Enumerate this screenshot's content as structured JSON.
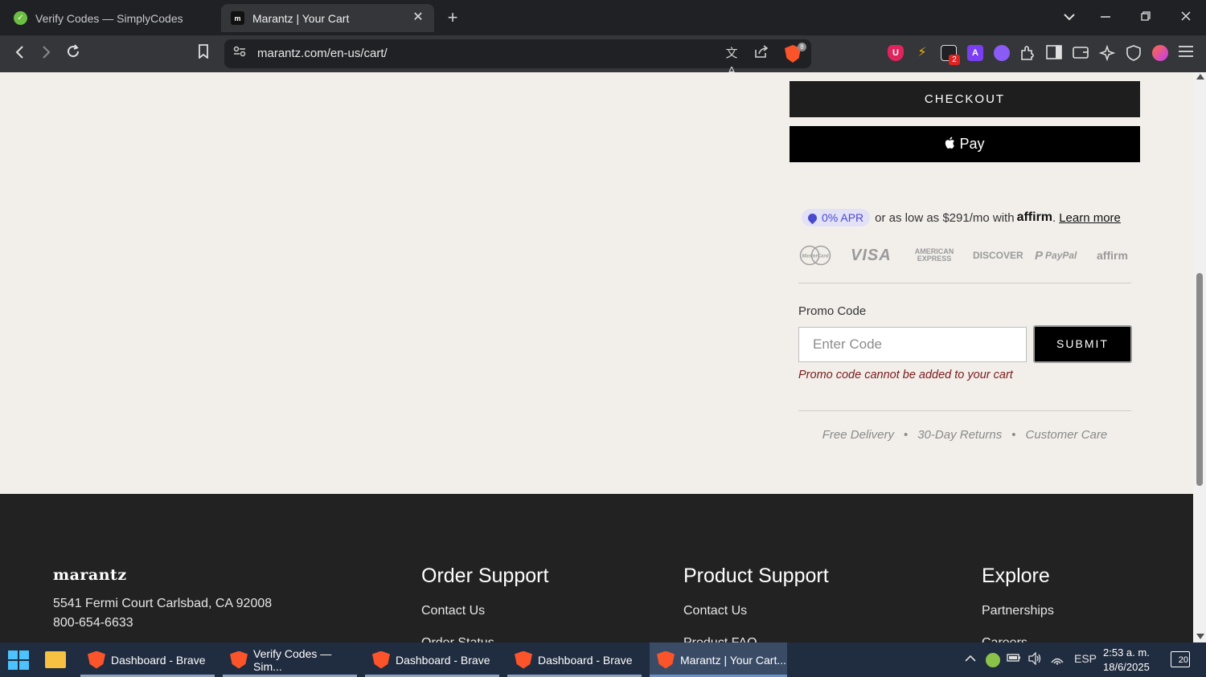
{
  "browser": {
    "tabs": [
      {
        "title": "Verify Codes — SimplyCodes",
        "active": false
      },
      {
        "title": "Marantz | Your Cart",
        "active": true
      }
    ],
    "new_tab_glyph": "+",
    "close_glyph": "✕",
    "url": "marantz.com/en-us/cart/",
    "shields_count": "8",
    "extension_badge": "2",
    "extension_a_letter": "A"
  },
  "cart": {
    "checkout_label": "CHECKOUT",
    "applepay_label": " Pay",
    "affirm": {
      "apr_label": "0% APR",
      "text": "or as low as $291/mo with",
      "brand": "affirm",
      "learn_more": "Learn more"
    },
    "payment_logos": [
      "MasterCard",
      "VISA",
      "AMERICAN EXPRESS",
      "DISCOVER",
      "PayPal",
      "affirm"
    ],
    "promo": {
      "label": "Promo Code",
      "placeholder": "Enter Code",
      "submit_label": "SUBMIT",
      "error": "Promo code cannot be added to your cart"
    },
    "benefits": [
      "Free Delivery",
      "30-Day Returns",
      "Customer Care"
    ],
    "benefit_separator": "•"
  },
  "footer": {
    "brand": "marantz",
    "address": "5541 Fermi Court Carlsbad, CA 92008",
    "phone": "800-654-6633",
    "columns": [
      {
        "title": "Order Support",
        "links": [
          "Contact Us",
          "Order Status"
        ]
      },
      {
        "title": "Product Support",
        "links": [
          "Contact Us",
          "Product FAQ"
        ]
      },
      {
        "title": "Explore",
        "links": [
          "Partnerships",
          "Careers"
        ]
      }
    ]
  },
  "taskbar": {
    "items": [
      {
        "label": "Dashboard - Brave",
        "active": false
      },
      {
        "label": "Verify Codes — Sim...",
        "active": false
      },
      {
        "label": "Dashboard - Brave",
        "active": false
      },
      {
        "label": "Dashboard - Brave",
        "active": false
      },
      {
        "label": "Marantz | Your Cart...",
        "active": true
      }
    ],
    "language": "ESP",
    "time": "2:53 a. m.",
    "date": "18/6/2025",
    "notification_count": "20"
  },
  "colors": {
    "page_bg": "#f2efeb",
    "checkout_bg": "#1e1e1e",
    "affirm_accent": "#4a4ad0",
    "error_text": "#7a1a1a",
    "footer_bg": "#222222"
  }
}
